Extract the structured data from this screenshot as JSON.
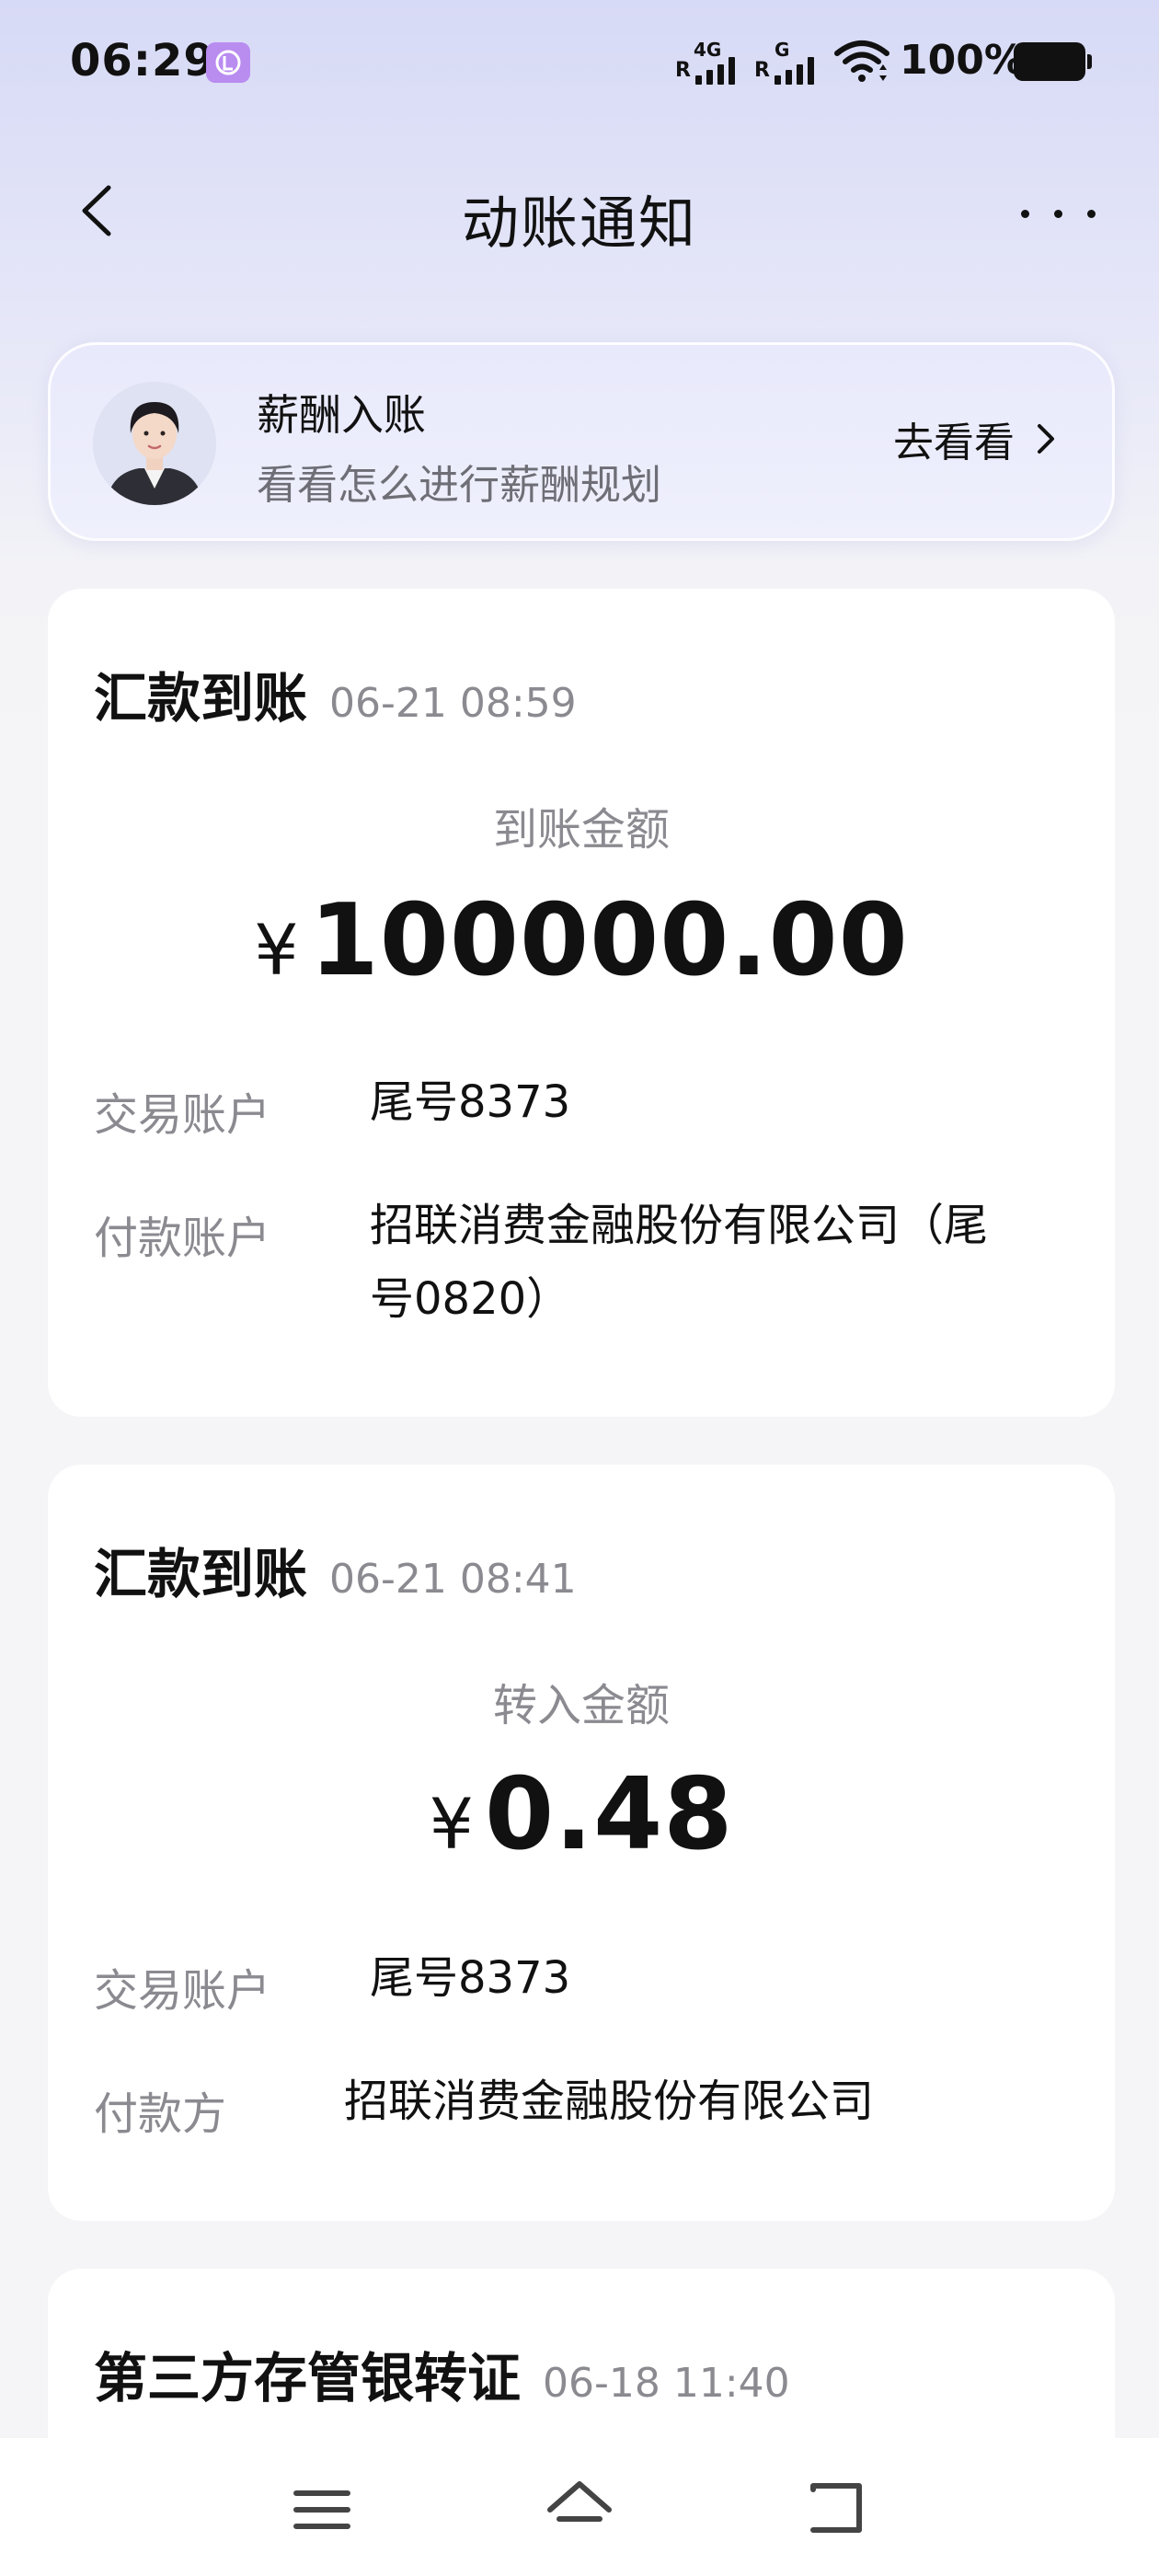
{
  "status_bar": {
    "time": "06:29",
    "sim1_type": "4G",
    "sim1_label": "R",
    "sim2_type": "G",
    "sim2_label": "R",
    "battery_percent": "100%"
  },
  "nav": {
    "title": "动账通知"
  },
  "banner": {
    "title": "薪酬入账",
    "subtitle": "看看怎么进行薪酬规划",
    "link_label": "去看看"
  },
  "cards": [
    {
      "title": "汇款到账",
      "time": "06-21 08:59",
      "amount_label": "到账金额",
      "currency": "¥",
      "amount": "100000.00",
      "rows": [
        {
          "label": "交易账户",
          "value": "尾号8373"
        },
        {
          "label": "付款账户",
          "value_line1": "招联消费金融股份有限公司（尾",
          "value_line2": "号0820）"
        }
      ]
    },
    {
      "title": "汇款到账",
      "time": "06-21 08:41",
      "amount_label": "转入金额",
      "currency": "¥",
      "amount": "0.48",
      "rows": [
        {
          "label": "交易账户",
          "value": "尾号8373"
        },
        {
          "label": "付款方",
          "value": "招联消费金融股份有限公司"
        }
      ]
    },
    {
      "title": "第三方存管银转证",
      "time": "06-18 11:40"
    }
  ],
  "colors": {
    "accent_badge": "#b98cf0",
    "text_primary": "#111111",
    "text_secondary": "#8a8a90"
  }
}
